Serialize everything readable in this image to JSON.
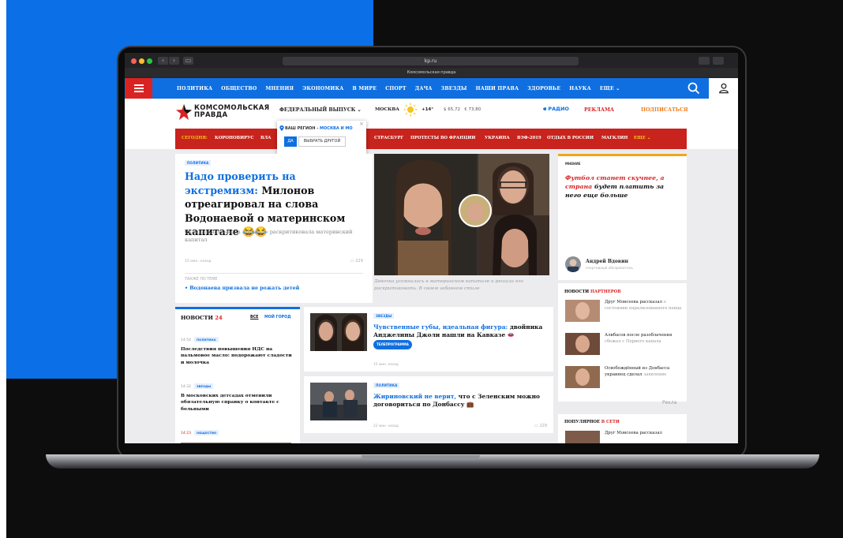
{
  "browser": {
    "url": "kp.ru",
    "tab_title": "Комсомольская правда"
  },
  "topnav": {
    "items": [
      "ПОЛИТИКА",
      "ОБЩЕСТВО",
      "МНЕНИЯ",
      "ЭКОНОМИКА",
      "В МИРЕ",
      "СПОРТ",
      "ДАЧА",
      "ЗВЕЗДЫ",
      "НАШИ ПРАВА",
      "ЗДОРОВЬЕ",
      "НАУКА",
      "ЕЩЕ ⌄"
    ]
  },
  "header": {
    "logo_line1": "КОМСОМОЛЬСКАЯ",
    "logo_line2": "ПРАВДА",
    "edition": "ФЕДЕРАЛЬНЫЙ ВЫПУСК ⌄",
    "city": "МОСКВА",
    "temperature": "+14°",
    "rate_usd": "$ 65,72",
    "rate_eur": "€ 73,80",
    "radio": "РАДИО",
    "ads": "РЕКЛАМА",
    "subscribe": "ПОДПИСАТЬСЯ"
  },
  "region_popup": {
    "label": "ВАШ РЕГИОН - ",
    "region": "МОСКВА И МО",
    "yes": "ДА",
    "choose_other": "ВЫБРАТЬ ДРУГОЙ",
    "close": "×"
  },
  "today_bar": {
    "label": "СЕГОДНЯ:",
    "items": [
      "КОРОНОВИРУС",
      "ВЛА",
      "СТРАСБУРГ",
      "ПРОТЕСТЫ ВО ФРАНЦИИ",
      "УКРАИНА",
      "ВЭФ-2019",
      "ОТДЫХ В РОССИИ",
      "МАГКЛИН",
      "ЕЩЕ ⌄"
    ]
  },
  "main_story": {
    "tag": "ПОЛИТИКА",
    "headline_blue": "Надо проверить на экстремизм:",
    "headline_black": "Милонов отреагировал на слова Водонаевой о материнском капитале",
    "emoji": "😂😂",
    "subtitle": "Скандальная звезда «Дома-2» раскритиковала материнский капитал",
    "time": "15 мин. назад",
    "comments": "229",
    "also_label": "ТАКЖЕ ПО ТЕМЕ",
    "also_link": "Водонаева призвала не рожать детей",
    "image_caption": "Девочка усомнилась в материнском капитале и решила его раскритиковать. В своем забавном стиле"
  },
  "opinion": {
    "tag": "МНЕНИЕ",
    "quote_red1": "Футбол станет скучнее, а",
    "quote_red2": "страна",
    "quote_black": "будет платить за него еще больше",
    "author": "Андрей Вдовин",
    "role": "спортивный обозреватель"
  },
  "news_list": {
    "title": "НОВОСТИ",
    "title_num": "24",
    "all": "ВСЕ",
    "my_region": "МОЙ ГОРОД",
    "items": [
      {
        "time": "14:54",
        "tag": "ПОЛИТИКА",
        "text": "Последствия повышения НДС на пальмовое масло: подорожают сладости и молочка"
      },
      {
        "time": "14:32",
        "tag": "ЗВЕЗДЫ",
        "text": "В московских детсадах отменили обязательную справку о контакте с больными"
      },
      {
        "time": "14:23",
        "tag": "ОБЩЕСТВО",
        "text": ""
      }
    ]
  },
  "mid_cards": [
    {
      "tag": "ЗВЕЗДЫ",
      "title_blue": "Чувственные губы, идеальная фигура:",
      "title_black": "двойника Анджелины Джоли нашли на Кавказе",
      "emoji": "👄",
      "pill": "ТЕЛЕПРОГРАММА",
      "time": "15 мин. назад",
      "comments": ""
    },
    {
      "tag": "ПОЛИТИКА",
      "title_blue": "Жириновский не верит,",
      "title_black": "что с Зеленским можно договориться по Донбассу",
      "emoji": "💼",
      "pill": "",
      "time": "22 мин. назад",
      "comments": "229"
    }
  ],
  "partners": {
    "title_black": "НОВОСТИ",
    "title_red": "ПАРТНЕРОВ",
    "items": [
      {
        "text": "Друг Моисеева рассказал",
        "gray": "о состоянии парализованного певца"
      },
      {
        "text": "Алибасов после разоблачения",
        "gray": "сбежал с Первого канала"
      },
      {
        "text": "Освобождённый из Донбасса украинец сделал",
        "gray": "заявление"
      }
    ],
    "ad_label": "Рекла"
  },
  "popular": {
    "title_black": "ПОПУЛЯРНОЕ",
    "title_red": "В СЕТИ",
    "item": "Друг Моисеева рассказал"
  },
  "colors": {
    "brand_blue": "#0f6fe0",
    "brand_red": "#d92323",
    "accent_orange": "#f2a51a"
  }
}
